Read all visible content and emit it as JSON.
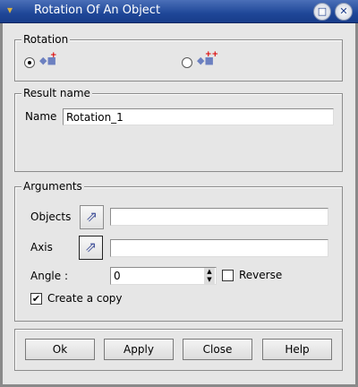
{
  "window": {
    "title": "Rotation Of An Object",
    "maximize_icon": "maximize-icon",
    "close_icon": "close-icon"
  },
  "rotation": {
    "label": "Rotation",
    "options": [
      {
        "icon": "rotation-axis-icon",
        "selected": true
      },
      {
        "icon": "rotation-three-points-icon",
        "selected": false
      }
    ]
  },
  "result": {
    "label": "Result name",
    "name_label": "Name",
    "name_value": "Rotation_1"
  },
  "arguments": {
    "label": "Arguments",
    "objects_label": "Objects",
    "objects_value": "",
    "axis_label": "Axis",
    "axis_value": "",
    "angle_label": "Angle :",
    "angle_value": "0",
    "reverse_label": "Reverse",
    "reverse_checked": false,
    "copy_label": "Create a copy",
    "copy_checked": true
  },
  "buttons": {
    "ok": "Ok",
    "apply": "Apply",
    "close": "Close",
    "help": "Help"
  }
}
